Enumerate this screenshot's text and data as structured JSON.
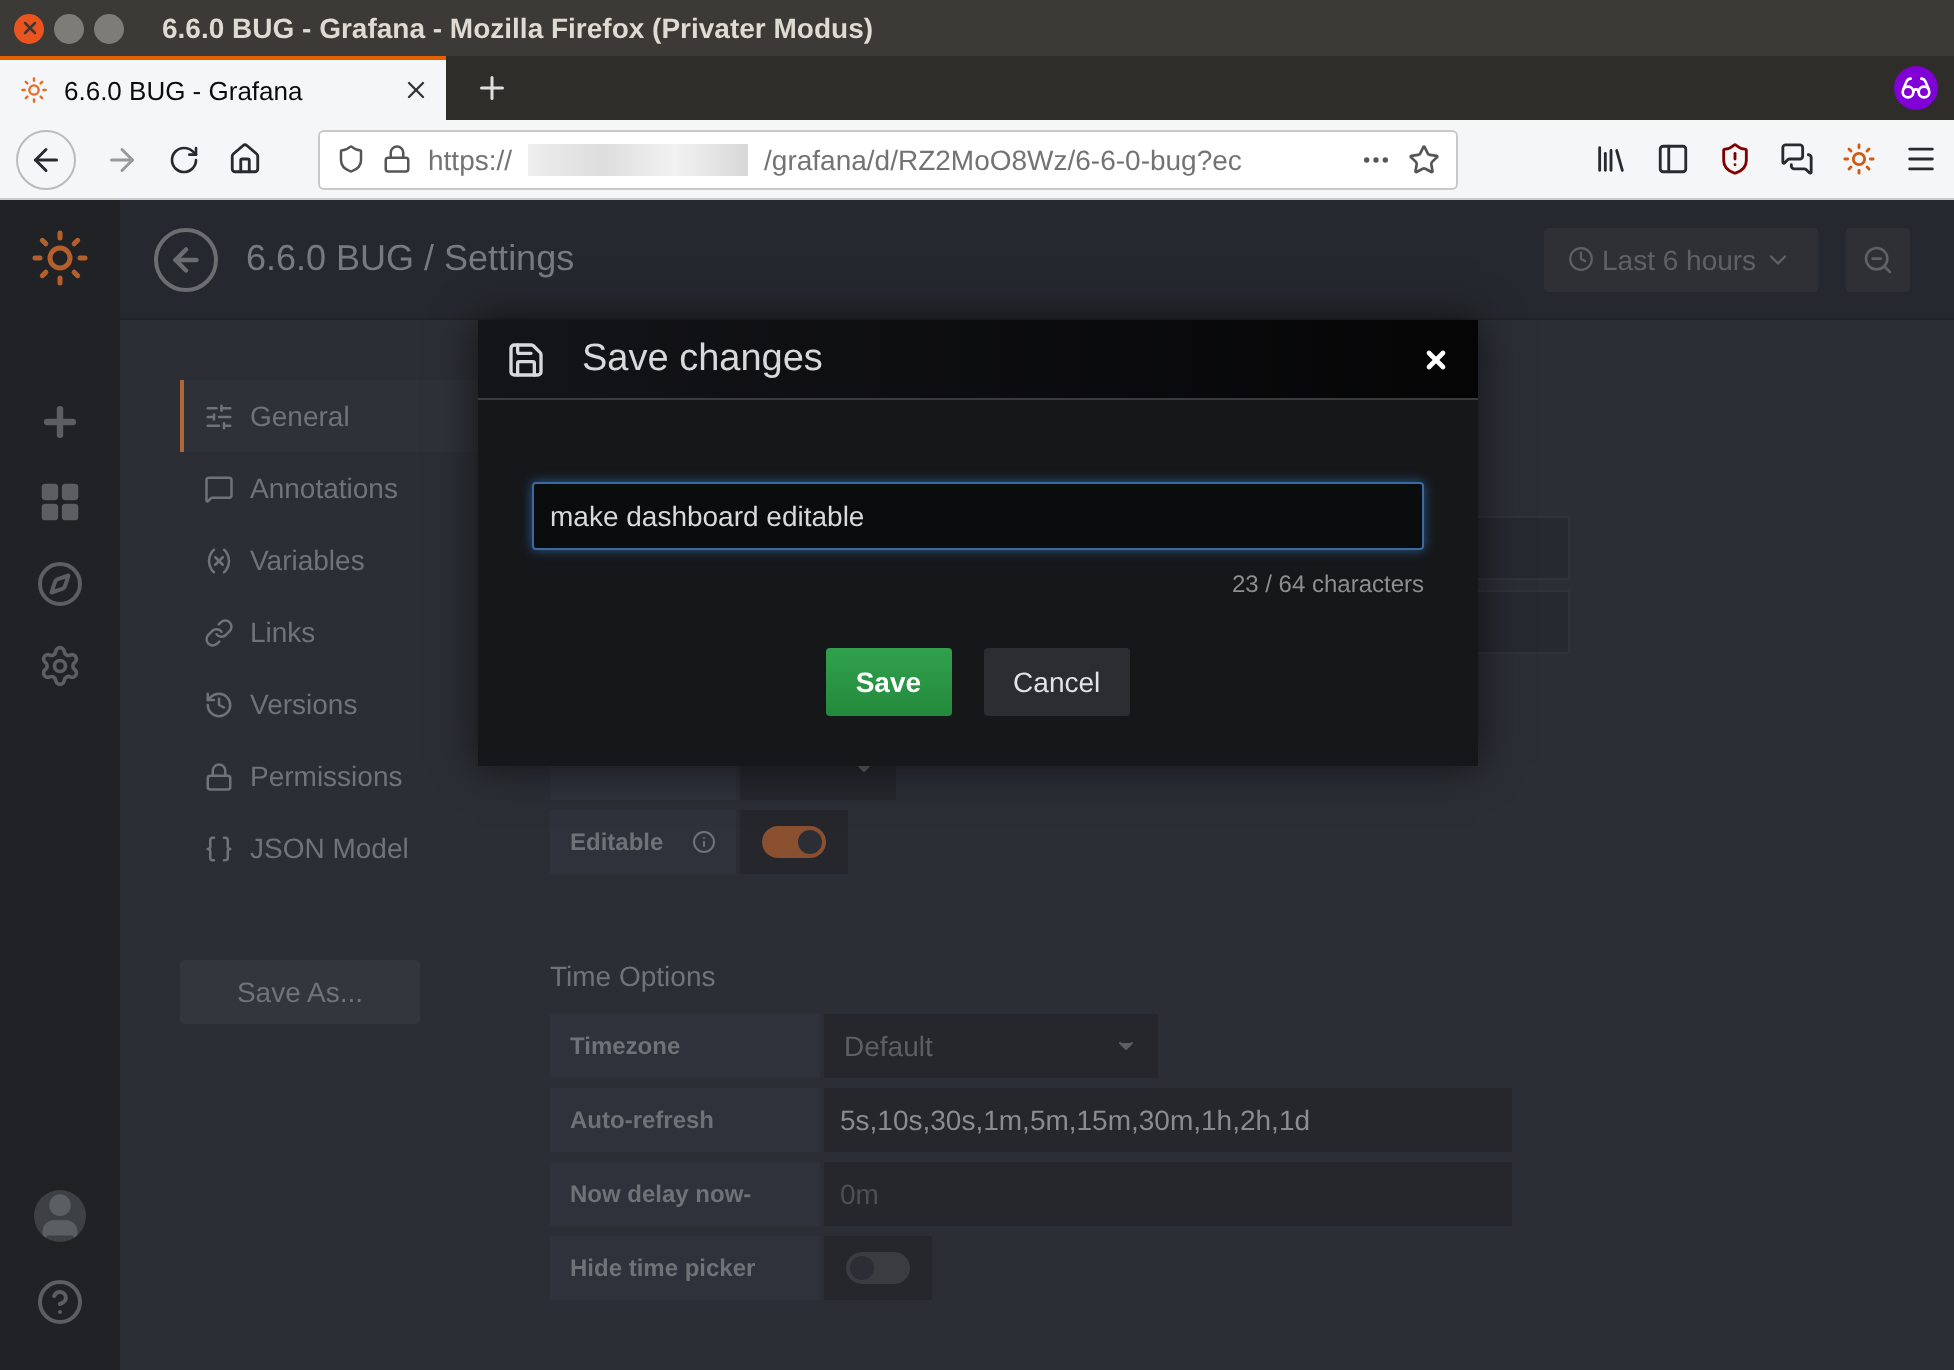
{
  "browser": {
    "window_title": "6.6.0 BUG - Grafana - Mozilla Firefox (Privater Modus)",
    "tab": {
      "title": "6.6.0 BUG - Grafana"
    },
    "url": {
      "scheme": "https://",
      "path": "/grafana/d/RZ2MoO8Wz/6-6-0-bug?ec"
    }
  },
  "header": {
    "title": "6.6.0 BUG / Settings",
    "time_picker": "Last 6 hours"
  },
  "settings_nav": {
    "items": [
      {
        "label": "General",
        "selected": true
      },
      {
        "label": "Annotations",
        "selected": false
      },
      {
        "label": "Variables",
        "selected": false
      },
      {
        "label": "Links",
        "selected": false
      },
      {
        "label": "Versions",
        "selected": false
      },
      {
        "label": "Permissions",
        "selected": false
      },
      {
        "label": "JSON Model",
        "selected": false
      }
    ],
    "save_as": "Save As..."
  },
  "general": {
    "rows": [
      {
        "label": "Editable",
        "kind": "switch",
        "info": true,
        "on": true
      }
    ]
  },
  "time_options": {
    "title": "Time Options",
    "rows": [
      {
        "label": "Timezone",
        "kind": "select",
        "value": "Default"
      },
      {
        "label": "Auto-refresh",
        "kind": "input",
        "value": "5s,10s,30s,1m,5m,15m,30m,1h,2h,1d"
      },
      {
        "label": "Now delay now-",
        "kind": "input",
        "placeholder": "0m"
      },
      {
        "label": "Hide time picker",
        "kind": "switch",
        "on": false
      }
    ]
  },
  "modal": {
    "title": "Save changes",
    "message": {
      "value": "make dashboard editable"
    },
    "counter": "23 / 64 characters",
    "buttons": [
      {
        "label": "Save",
        "kind": "primary"
      },
      {
        "label": "Cancel",
        "kind": "secondary"
      }
    ]
  }
}
